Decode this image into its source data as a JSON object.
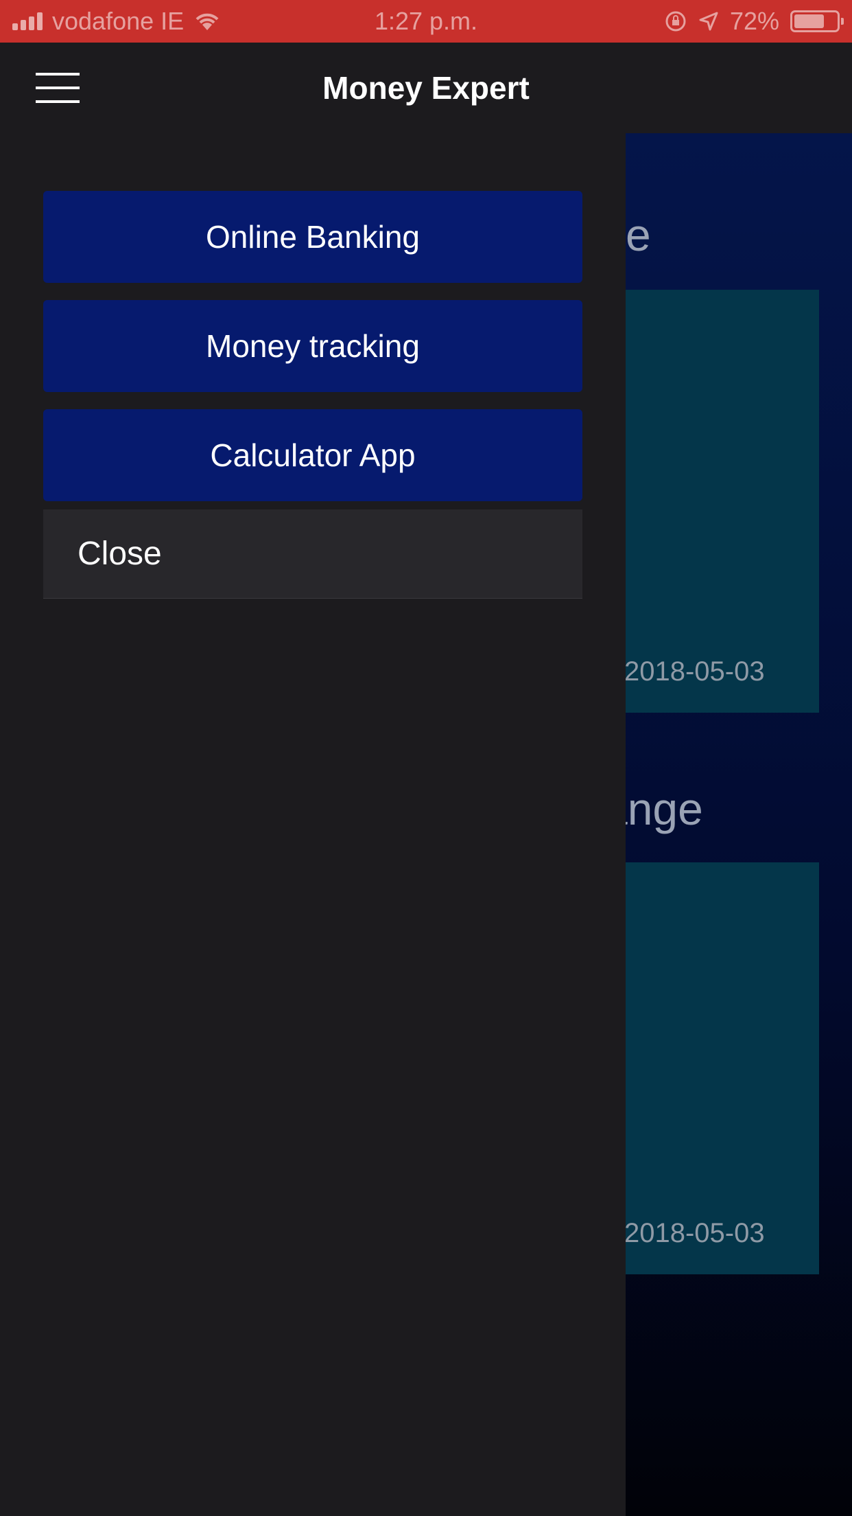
{
  "status_bar": {
    "carrier": "vodafone IE",
    "time": "1:27 p.m.",
    "battery": "72%"
  },
  "nav_bar": {
    "title": "Money Expert"
  },
  "drawer": {
    "items": [
      {
        "label": "Online Banking"
      },
      {
        "label": "Money tracking"
      },
      {
        "label": "Calculator App"
      }
    ],
    "close_label": "Close"
  },
  "background": {
    "section1_heading_fragment": "e",
    "section1_date": "2018-05-03",
    "section2_heading_fragment": "ange",
    "section2_date": "2018-05-03"
  },
  "colors": {
    "status_bar": "#c8302c",
    "drawer_button": "#061a6e",
    "drawer_background": "#1c1b1e",
    "card": "#04364a"
  }
}
